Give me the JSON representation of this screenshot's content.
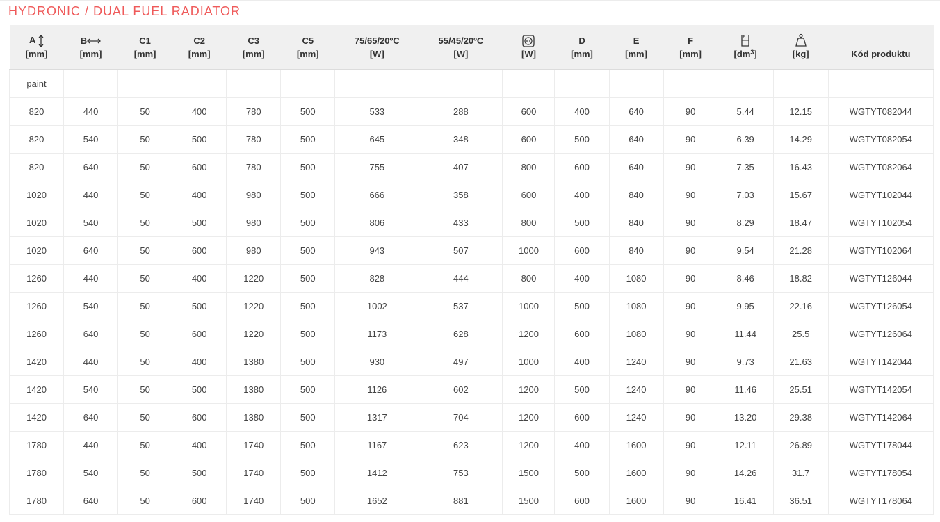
{
  "title": "HYDRONIC / DUAL FUEL RADIATOR",
  "accent_color": "#ef5a5a",
  "columns": [
    {
      "key": "a",
      "name": "A",
      "unit": "[mm]",
      "icon": "vertical-arrow-icon"
    },
    {
      "key": "b",
      "name": "B",
      "unit": "[mm]",
      "icon": "horizontal-arrow-icon"
    },
    {
      "key": "c1",
      "name": "C1",
      "unit": "[mm]"
    },
    {
      "key": "c2",
      "name": "C2",
      "unit": "[mm]"
    },
    {
      "key": "c3",
      "name": "C3",
      "unit": "[mm]"
    },
    {
      "key": "c5",
      "name": "C5",
      "unit": "[mm]"
    },
    {
      "key": "p75",
      "name": "75/65/20ºC",
      "unit": "[W]"
    },
    {
      "key": "p55",
      "name": "55/45/20ºC",
      "unit": "[W]"
    },
    {
      "key": "heater",
      "name": "",
      "unit": "[W]",
      "icon": "electric-socket-icon"
    },
    {
      "key": "d",
      "name": "D",
      "unit": "[mm]"
    },
    {
      "key": "e",
      "name": "E",
      "unit": "[mm]"
    },
    {
      "key": "f",
      "name": "F",
      "unit": "[mm]"
    },
    {
      "key": "vol",
      "name": "",
      "unit_prefix": "[dm",
      "unit_sup": "3",
      "unit_suffix": "]",
      "icon": "water-container-icon"
    },
    {
      "key": "weight",
      "name": "",
      "unit": "[kg]",
      "icon": "weight-icon"
    },
    {
      "key": "code",
      "name": "Kód produktu",
      "unit": ""
    }
  ],
  "finish_label": "paint",
  "rows": [
    [
      "820",
      "440",
      "50",
      "400",
      "780",
      "500",
      "533",
      "288",
      "600",
      "400",
      "640",
      "90",
      "5.44",
      "12.15",
      "WGTYT082044"
    ],
    [
      "820",
      "540",
      "50",
      "500",
      "780",
      "500",
      "645",
      "348",
      "600",
      "500",
      "640",
      "90",
      "6.39",
      "14.29",
      "WGTYT082054"
    ],
    [
      "820",
      "640",
      "50",
      "600",
      "780",
      "500",
      "755",
      "407",
      "800",
      "600",
      "640",
      "90",
      "7.35",
      "16.43",
      "WGTYT082064"
    ],
    [
      "1020",
      "440",
      "50",
      "400",
      "980",
      "500",
      "666",
      "358",
      "600",
      "400",
      "840",
      "90",
      "7.03",
      "15.67",
      "WGTYT102044"
    ],
    [
      "1020",
      "540",
      "50",
      "500",
      "980",
      "500",
      "806",
      "433",
      "800",
      "500",
      "840",
      "90",
      "8.29",
      "18.47",
      "WGTYT102054"
    ],
    [
      "1020",
      "640",
      "50",
      "600",
      "980",
      "500",
      "943",
      "507",
      "1000",
      "600",
      "840",
      "90",
      "9.54",
      "21.28",
      "WGTYT102064"
    ],
    [
      "1260",
      "440",
      "50",
      "400",
      "1220",
      "500",
      "828",
      "444",
      "800",
      "400",
      "1080",
      "90",
      "8.46",
      "18.82",
      "WGTYT126044"
    ],
    [
      "1260",
      "540",
      "50",
      "500",
      "1220",
      "500",
      "1002",
      "537",
      "1000",
      "500",
      "1080",
      "90",
      "9.95",
      "22.16",
      "WGTYT126054"
    ],
    [
      "1260",
      "640",
      "50",
      "600",
      "1220",
      "500",
      "1173",
      "628",
      "1200",
      "600",
      "1080",
      "90",
      "11.44",
      "25.5",
      "WGTYT126064"
    ],
    [
      "1420",
      "440",
      "50",
      "400",
      "1380",
      "500",
      "930",
      "497",
      "1000",
      "400",
      "1240",
      "90",
      "9.73",
      "21.63",
      "WGTYT142044"
    ],
    [
      "1420",
      "540",
      "50",
      "500",
      "1380",
      "500",
      "1126",
      "602",
      "1200",
      "500",
      "1240",
      "90",
      "11.46",
      "25.51",
      "WGTYT142054"
    ],
    [
      "1420",
      "640",
      "50",
      "600",
      "1380",
      "500",
      "1317",
      "704",
      "1200",
      "600",
      "1240",
      "90",
      "13.20",
      "29.38",
      "WGTYT142064"
    ],
    [
      "1780",
      "440",
      "50",
      "400",
      "1740",
      "500",
      "1167",
      "623",
      "1200",
      "400",
      "1600",
      "90",
      "12.11",
      "26.89",
      "WGTYT178044"
    ],
    [
      "1780",
      "540",
      "50",
      "500",
      "1740",
      "500",
      "1412",
      "753",
      "1500",
      "500",
      "1600",
      "90",
      "14.26",
      "31.7",
      "WGTYT178054"
    ],
    [
      "1780",
      "640",
      "50",
      "600",
      "1740",
      "500",
      "1652",
      "881",
      "1500",
      "600",
      "1600",
      "90",
      "16.41",
      "36.51",
      "WGTYT178064"
    ]
  ]
}
